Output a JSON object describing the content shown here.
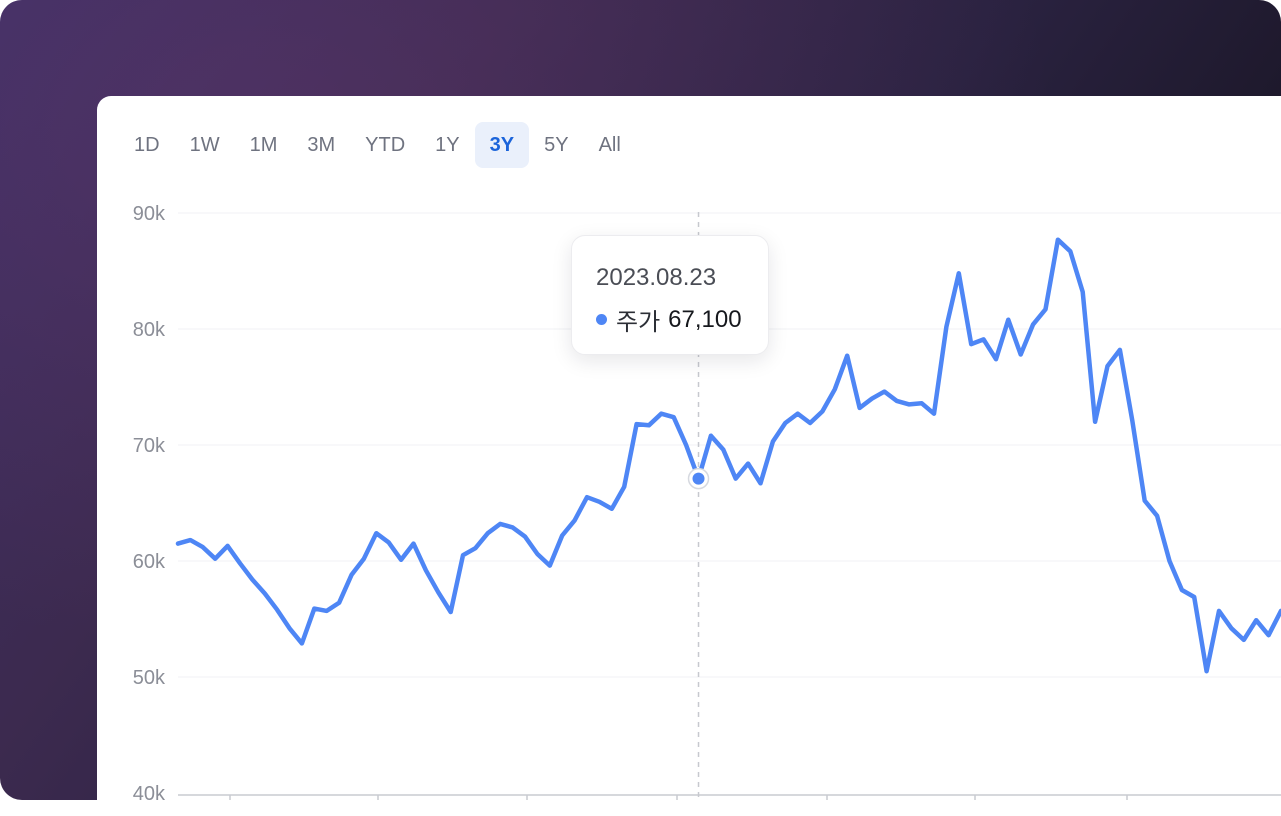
{
  "range_tabs": [
    "1D",
    "1W",
    "1M",
    "3M",
    "YTD",
    "1Y",
    "3Y",
    "5Y",
    "All"
  ],
  "active_tab": "3Y",
  "tooltip": {
    "date": "2023.08.23",
    "series_label": "주가",
    "value": "67,100"
  },
  "colors": {
    "line": "#4e86f5",
    "accent": "#1b64da",
    "grid": "#f0f1f4",
    "background_gradient": [
      "#3d2f63",
      "#121018"
    ]
  },
  "chart_data": {
    "type": "line",
    "title": "",
    "xlabel": "",
    "ylabel": "",
    "ylim": [
      40000,
      90000
    ],
    "y_ticks": [
      "40k",
      "50k",
      "60k",
      "70k",
      "80k",
      "90k"
    ],
    "y_tick_values": [
      40000,
      50000,
      60000,
      70000,
      80000,
      90000
    ],
    "x_ticks": [],
    "grid": true,
    "highlight": {
      "index": 42,
      "value": 67100,
      "label": "2023.08.23"
    },
    "series": [
      {
        "name": "주가",
        "values": [
          61500,
          61800,
          61200,
          60200,
          61300,
          59800,
          58400,
          57200,
          55800,
          54200,
          52900,
          55900,
          55700,
          56400,
          58800,
          60200,
          62400,
          61600,
          60100,
          61500,
          59200,
          57300,
          55600,
          60500,
          61100,
          62400,
          63200,
          62900,
          62100,
          60600,
          59600,
          62200,
          63500,
          65500,
          65100,
          64500,
          66400,
          71800,
          71700,
          72700,
          72400,
          70000,
          67100,
          70800,
          69600,
          67100,
          68400,
          66700,
          70300,
          71900,
          72700,
          71900,
          72900,
          74800,
          77700,
          73200,
          74000,
          74600,
          73800,
          73500,
          73600,
          72700,
          80200,
          84800,
          78700,
          79100,
          77400,
          80800,
          77800,
          80400,
          81700,
          87700,
          86700,
          83200,
          72000,
          76800,
          78200,
          72100,
          65200,
          63900,
          60000,
          57500,
          56900,
          50500,
          55700,
          54200,
          53200,
          54900,
          53600,
          55700
        ]
      }
    ]
  }
}
